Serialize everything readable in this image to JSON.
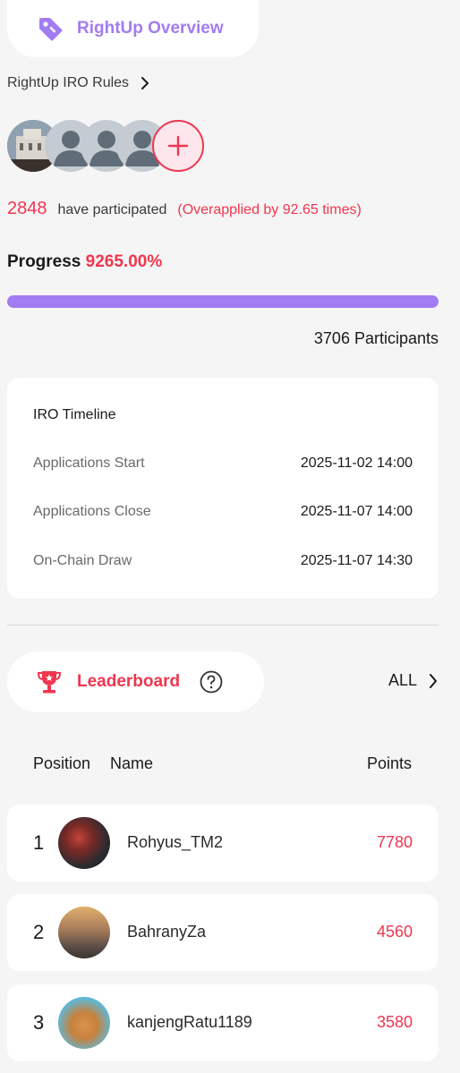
{
  "header": {
    "title": "RightUp Overview",
    "icon": "tag-icon",
    "accent": "#a27cf2"
  },
  "rules": {
    "label": "RightUp IRO Rules"
  },
  "participation": {
    "count": "2848",
    "text": "have participated",
    "overapplied": "(Overapplied by 92.65 times)"
  },
  "progress": {
    "label": "Progress",
    "percent_text": "9265.00%",
    "fill_fraction": 1.0
  },
  "participants_text": "3706 Participants",
  "timeline": {
    "title": "IRO Timeline",
    "rows": [
      {
        "label": "Applications Start",
        "value": "2025-11-02 14:00"
      },
      {
        "label": "Applications Close",
        "value": "2025-11-07 14:00"
      },
      {
        "label": "On-Chain Draw",
        "value": "2025-11-07 14:30"
      }
    ]
  },
  "leaderboard": {
    "title": "Leaderboard",
    "all_label": "ALL",
    "headers": {
      "position": "Position",
      "name": "Name",
      "points": "Points"
    },
    "rows": [
      {
        "rank": "1",
        "name": "Rohyus_TM2",
        "points": "7780"
      },
      {
        "rank": "2",
        "name": "BahranyZa",
        "points": "4560"
      },
      {
        "rank": "3",
        "name": "kanjengRatu1189",
        "points": "3580"
      }
    ]
  },
  "colors": {
    "brand_purple": "#a27cf2",
    "accent_red": "#f0364f",
    "background": "#f5f5f5"
  }
}
